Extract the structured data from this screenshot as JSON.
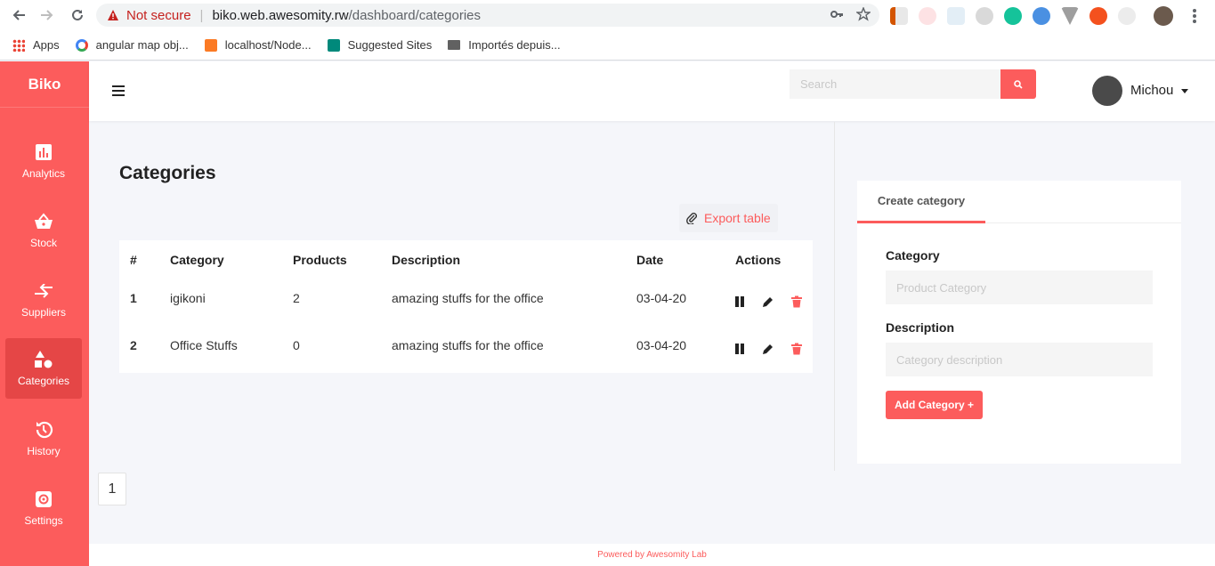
{
  "browser": {
    "security_label": "Not secure",
    "url_host": "biko.web.awesomity.rw",
    "url_path": "/dashboard/categories",
    "bookmarks": [
      {
        "label": "Apps"
      },
      {
        "label": "angular map obj..."
      },
      {
        "label": "localhost/Node..."
      },
      {
        "label": "Suggested Sites"
      },
      {
        "label": "Importés depuis..."
      }
    ]
  },
  "sidebar": {
    "brand": "Biko",
    "items": [
      {
        "label": "Analytics",
        "icon": "bar-chart-icon"
      },
      {
        "label": "Stock",
        "icon": "basket-icon"
      },
      {
        "label": "Suppliers",
        "icon": "arrows-exchange-icon"
      },
      {
        "label": "Categories",
        "icon": "shapes-icon",
        "active": true
      },
      {
        "label": "History",
        "icon": "history-icon"
      },
      {
        "label": "Settings",
        "icon": "gear-icon"
      }
    ],
    "accent": "#fc5c5c"
  },
  "header": {
    "search_placeholder": "Search",
    "user_name": "Michou"
  },
  "main": {
    "title": "Categories",
    "export_label": "Export table",
    "table": {
      "columns": [
        "#",
        "Category",
        "Products",
        "Description",
        "Date",
        "Actions"
      ],
      "rows": [
        {
          "num": "1",
          "category": "igikoni",
          "products": "2",
          "description": "amazing stuffs for the office",
          "date": "03-04-20"
        },
        {
          "num": "2",
          "category": "Office Stuffs",
          "products": "0",
          "description": "amazing stuffs for the office",
          "date": "03-04-20"
        }
      ]
    },
    "pagination": {
      "current": "1"
    }
  },
  "create_panel": {
    "tab_label": "Create category",
    "category_label": "Category",
    "category_placeholder": "Product Category",
    "description_label": "Description",
    "description_placeholder": "Category description",
    "submit_label": "Add Category +"
  },
  "footer": {
    "text": "Powered by Awesomity Lab"
  }
}
